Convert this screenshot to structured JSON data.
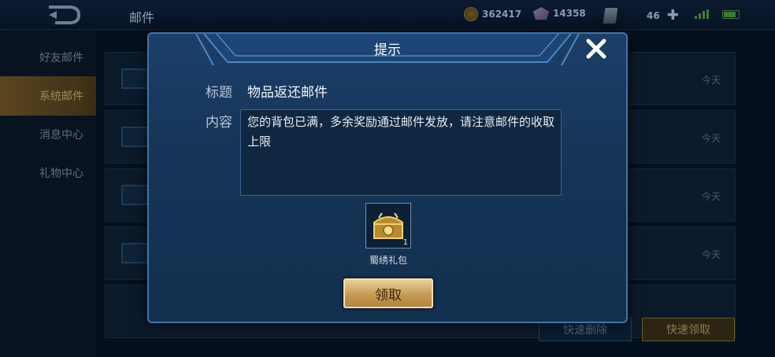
{
  "header": {
    "page_title": "邮件",
    "gold": "362417",
    "gems": "14358",
    "cards": "46"
  },
  "sidebar": {
    "items": [
      {
        "label": "好友邮件"
      },
      {
        "label": "系统邮件"
      },
      {
        "label": "消息中心"
      },
      {
        "label": "礼物中心"
      }
    ]
  },
  "mail_list": {
    "dates": [
      "今天",
      "今天",
      "今天",
      "今天"
    ],
    "quick_delete_label": "快速删除",
    "quick_claim_label": "快速领取"
  },
  "dialog": {
    "title": "提示",
    "subject_label": "标题",
    "subject": "物品返还邮件",
    "content_label": "内容",
    "content": "您的背包已满，多余奖励通过邮件发放，请注意邮件的收取上限",
    "attachment": {
      "name": "蜀绣礼包",
      "count": "1"
    },
    "claim_label": "领取"
  },
  "icons": {
    "back": "back-arrow-icon",
    "gold": "gold-coin-icon",
    "gem": "diamond-gem-icon",
    "card": "card-icon",
    "close": "close-icon",
    "chest": "treasure-chest-icon"
  },
  "colors": {
    "dialog_bg": "#163558",
    "dialog_border": "#3f74a8",
    "claim_button": "#c59b55"
  }
}
